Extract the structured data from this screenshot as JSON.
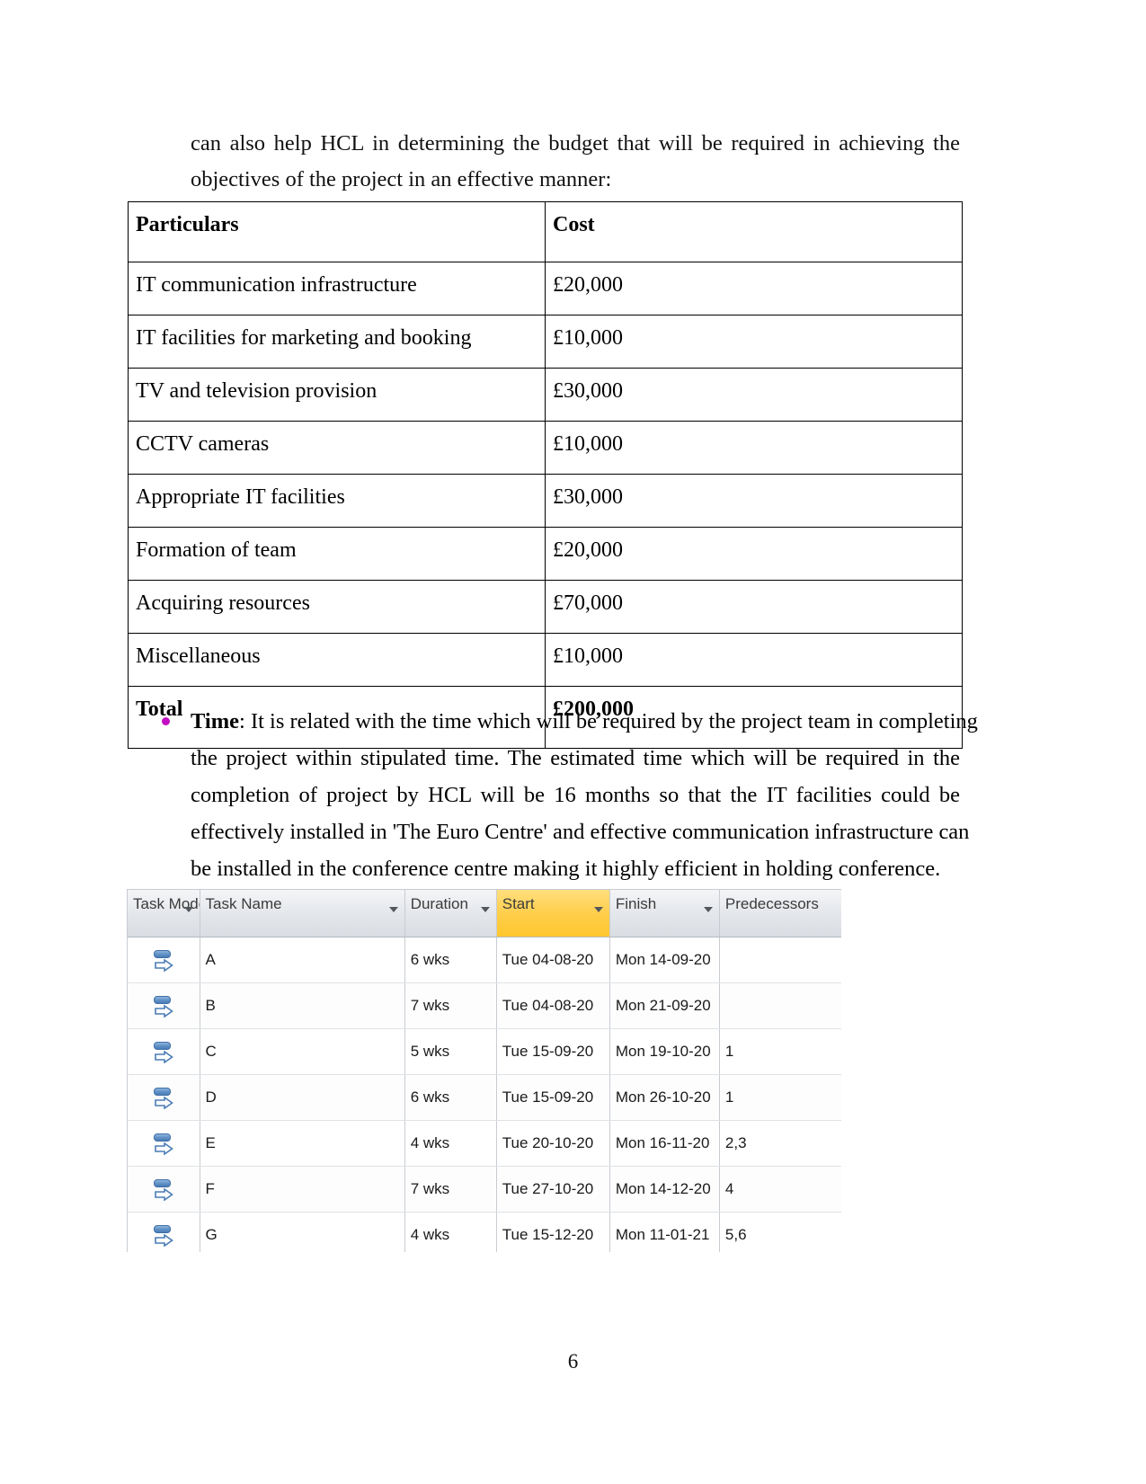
{
  "document": {
    "page_number": "6",
    "intro_paragraph": {
      "line1": "can also help HCL in determining the budget that will be required in achieving the",
      "line2": "objectives of the project in an effective manner:"
    }
  },
  "cost_table": {
    "headers": [
      "Particulars",
      "Cost"
    ],
    "rows": [
      {
        "particulars": "IT communication infrastructure",
        "cost": "£20,000"
      },
      {
        "particulars": "IT facilities for marketing and booking",
        "cost": "£10,000"
      },
      {
        "particulars": "TV and television provision",
        "cost": "£30,000"
      },
      {
        "particulars": "CCTV cameras",
        "cost": "£10,000"
      },
      {
        "particulars": "Appropriate IT facilities",
        "cost": "£30,000"
      },
      {
        "particulars": "Formation of team",
        "cost": "£20,000"
      },
      {
        "particulars": "Acquiring resources",
        "cost": "£70,000"
      },
      {
        "particulars": "Miscellaneous",
        "cost": "£10,000"
      }
    ],
    "total": {
      "particulars": "Total",
      "cost": "£200,000"
    }
  },
  "time_bullet": {
    "label": "Time",
    "colon": ":",
    "line1_rest": " It is related with the time which will be required by the project team in completing",
    "line2": "the project within stipulated time. The estimated time which will be required in the",
    "line3": "completion of project by HCL will be 16 months so that the IT facilities could be",
    "line4": "effectively installed in 'The Euro Centre' and effective communication infrastructure can",
    "line5": "be installed in the conference centre making it highly efficient in holding conference."
  },
  "project_grid": {
    "columns": [
      {
        "label": "Task Mode",
        "highlighted": false
      },
      {
        "label": "Task Name",
        "highlighted": false
      },
      {
        "label": "Duration",
        "highlighted": false
      },
      {
        "label": "Start",
        "highlighted": true
      },
      {
        "label": "Finish",
        "highlighted": false
      },
      {
        "label": "Predecessors",
        "highlighted": false
      }
    ],
    "highlight_color": "#ffcd47",
    "task_mode_icon": "manually-scheduled-icon",
    "rows": [
      {
        "name": "A",
        "duration": "6 wks",
        "start": "Tue 04-08-20",
        "finish": "Mon 14-09-20",
        "predecessors": ""
      },
      {
        "name": "B",
        "duration": "7 wks",
        "start": "Tue 04-08-20",
        "finish": "Mon 21-09-20",
        "predecessors": ""
      },
      {
        "name": "C",
        "duration": "5 wks",
        "start": "Tue 15-09-20",
        "finish": "Mon 19-10-20",
        "predecessors": "1"
      },
      {
        "name": "D",
        "duration": "6 wks",
        "start": "Tue 15-09-20",
        "finish": "Mon 26-10-20",
        "predecessors": "1"
      },
      {
        "name": "E",
        "duration": "4 wks",
        "start": "Tue 20-10-20",
        "finish": "Mon 16-11-20",
        "predecessors": "2,3"
      },
      {
        "name": "F",
        "duration": "7 wks",
        "start": "Tue 27-10-20",
        "finish": "Mon 14-12-20",
        "predecessors": "4"
      },
      {
        "name": "G",
        "duration": "4 wks",
        "start": "Tue 15-12-20",
        "finish": "Mon 11-01-21",
        "predecessors": "5,6"
      }
    ]
  }
}
